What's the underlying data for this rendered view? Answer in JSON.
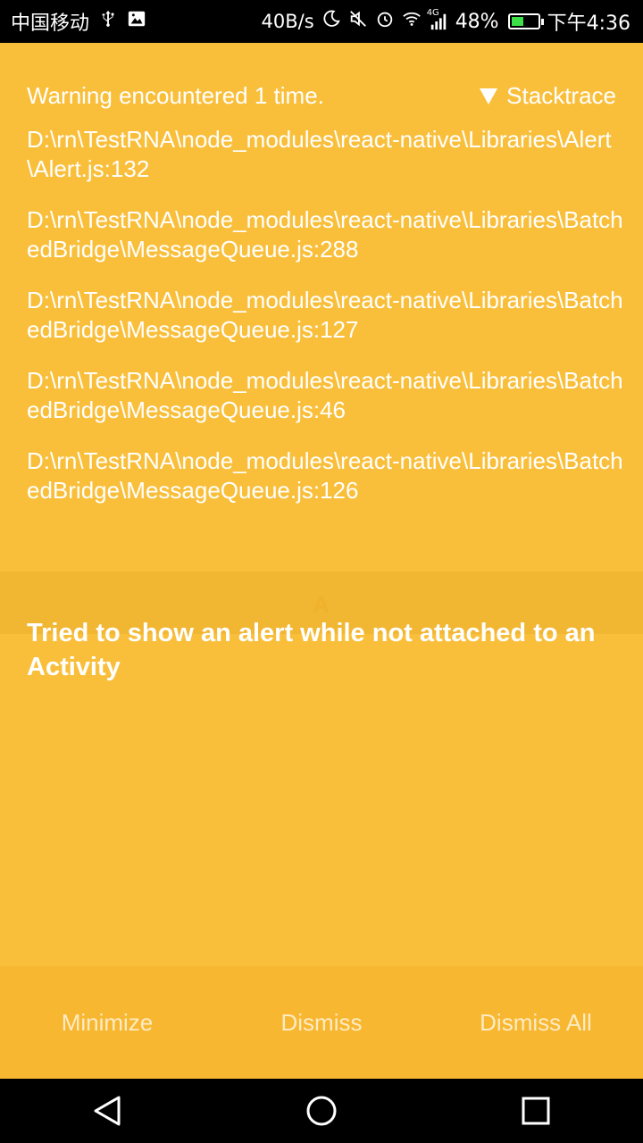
{
  "status_bar": {
    "carrier": "中国移动",
    "net_speed": "40B/s",
    "network_type": "4G",
    "battery_percent": "48%",
    "time": "下午4:36",
    "battery_level": 0.48,
    "battery_color": "#3ee04a"
  },
  "warning": {
    "header": "Warning encountered 1 time.",
    "stacktrace_label": "Stacktrace",
    "frames": [
      "D:\\rn\\TestRNA\\node_modules\\react-native\\Libraries\\Alert\\Alert.js:132",
      "D:\\rn\\TestRNA\\node_modules\\react-native\\Libraries\\BatchedBridge\\MessageQueue.js:288",
      "D:\\rn\\TestRNA\\node_modules\\react-native\\Libraries\\BatchedBridge\\MessageQueue.js:127",
      "D:\\rn\\TestRNA\\node_modules\\react-native\\Libraries\\BatchedBridge\\MessageQueue.js:46",
      "D:\\rn\\TestRNA\\node_modules\\react-native\\Libraries\\BatchedBridge\\MessageQueue.js:126"
    ],
    "message": "Tried to show an alert while not attached to an Activity",
    "ghost_text": "A"
  },
  "buttons": {
    "minimize": "Minimize",
    "dismiss": "Dismiss",
    "dismiss_all": "Dismiss All"
  },
  "colors": {
    "background": "#f9bf3b",
    "button_bar": "#f8b730",
    "text": "#ffffff"
  }
}
